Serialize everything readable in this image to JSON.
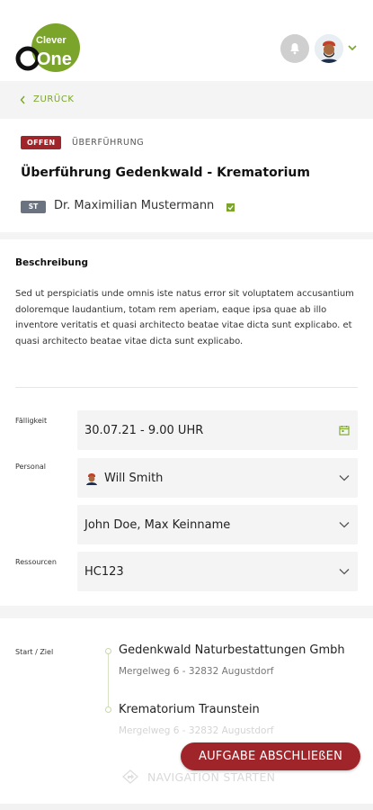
{
  "brand": {
    "logo_top": "Clever",
    "logo_bottom": "One",
    "accent": "#7aa52a",
    "danger": "#a0252a"
  },
  "header": {
    "bell_icon": "bell-icon",
    "avatar_icon": "user-avatar",
    "menu_icon": "chevron-down-icon"
  },
  "nav": {
    "back_label": "ZURÜCK"
  },
  "task": {
    "status": "OFFEN",
    "type": "ÜBERFÜHRUNG",
    "title": "Überführung Gedenkwald - Krematorium",
    "person_tag": "ST",
    "person_name": "Dr. Maximilian Mustermann"
  },
  "description": {
    "title": "Beschreibung",
    "text": "Sed ut perspiciatis unde omnis iste natus error sit voluptatem accusantium doloremque laudantium, totam rem aperiam, eaque ipsa quae ab illo inventore veritatis et quasi architecto beatae vitae dicta sunt explicabo. et quasi architecto beatae vitae dicta sunt explicabo."
  },
  "form": {
    "due_label": "Fälligkeit",
    "due_value": "30.07.21 - 9.00 UHR",
    "staff_label": "Personal",
    "staff_primary": "Will Smith",
    "staff_secondary": "John Doe, Max Keinname",
    "resources_label": "Ressourcen",
    "resources_value": "HC123"
  },
  "route": {
    "label": "Start / Ziel",
    "start_name": "Gedenkwald Naturbestattungen Gmbh",
    "start_address": "Mergelweg 6 - 32832 Augustdorf",
    "end_name": "Krematorium Traunstein",
    "end_address": "Mergelweg 6 - 32832 Augustdorf"
  },
  "actions": {
    "complete_label": "AUFGABE ABSCHLIEßEN",
    "navigate_label": "NAVIGATION STARTEN"
  }
}
